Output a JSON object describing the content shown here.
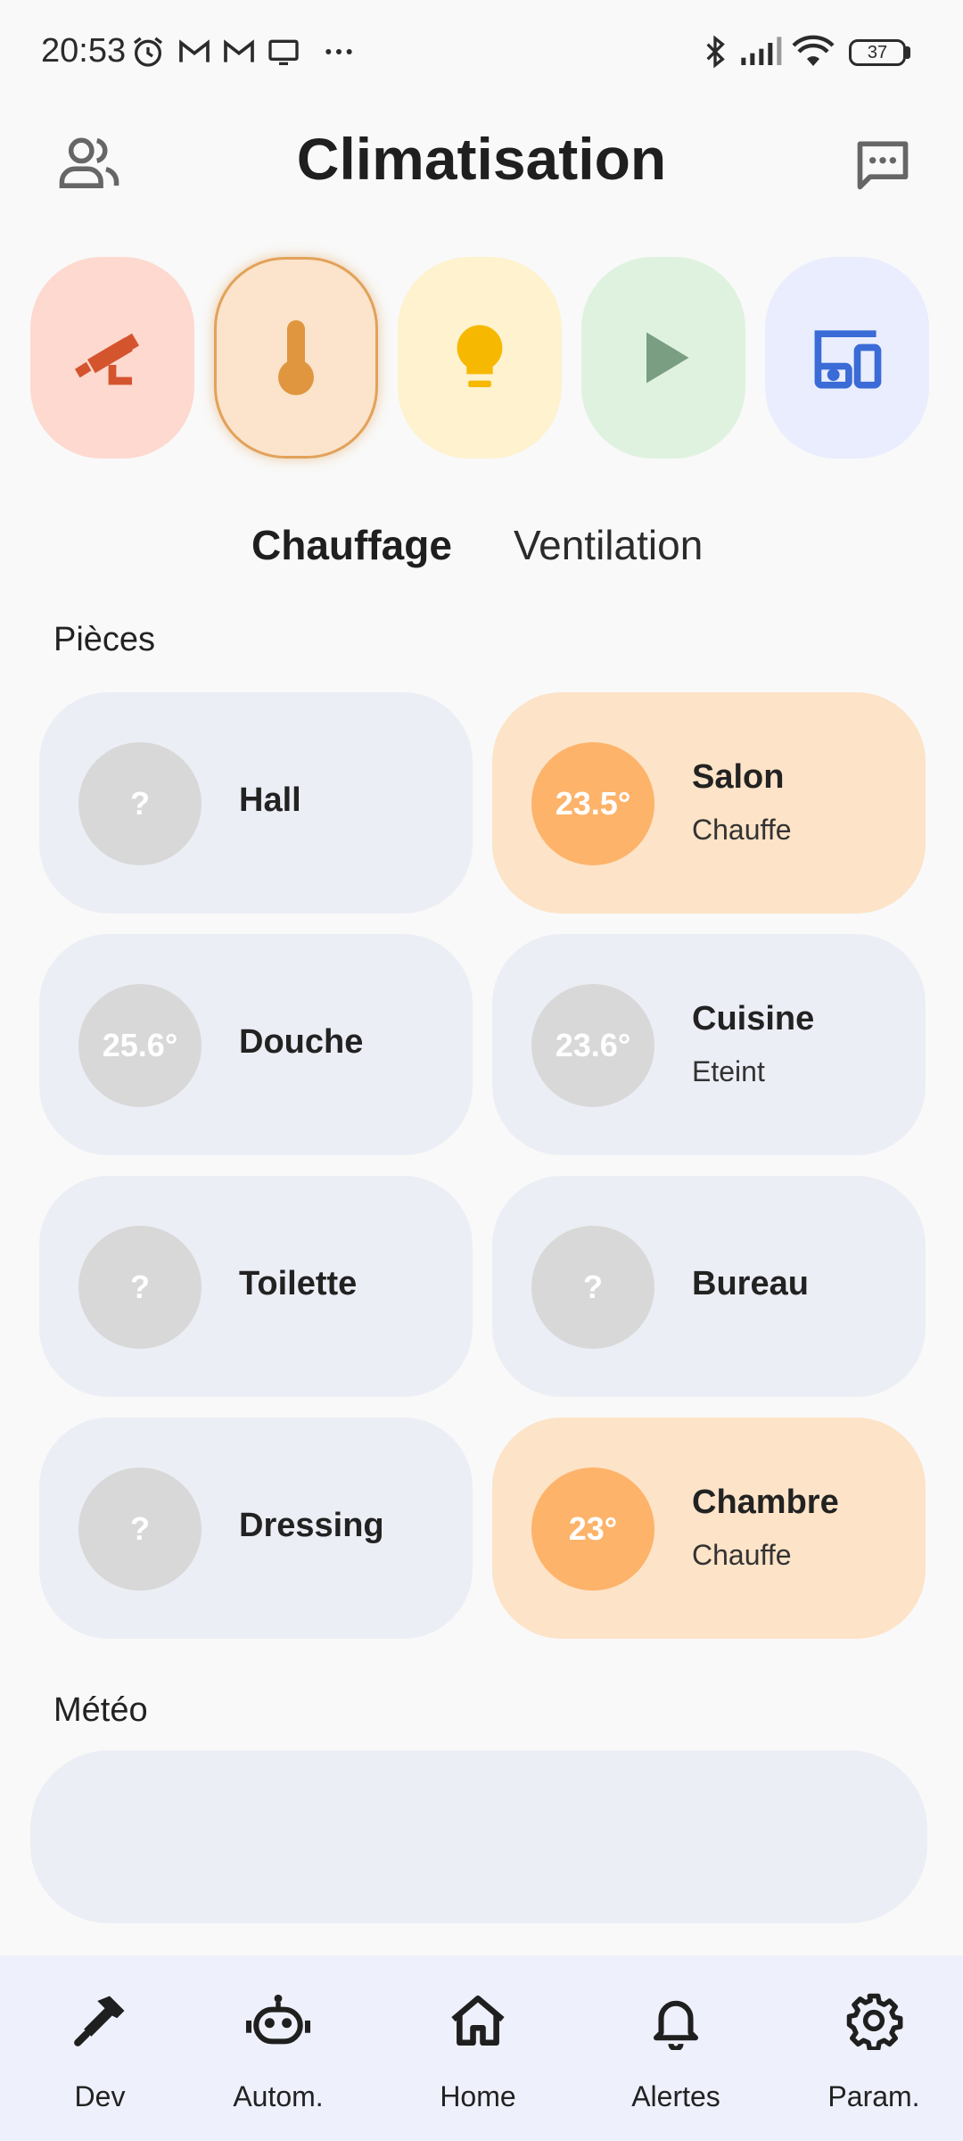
{
  "status_bar": {
    "time": "20:53",
    "icons": [
      "alarm-icon",
      "gmail-icon",
      "gmail-icon",
      "cast-icon",
      "more-icon",
      "bluetooth-icon",
      "signal-icon",
      "wifi-icon"
    ],
    "battery": "37"
  },
  "header": {
    "title": "Climatisation",
    "left_icon": "users-icon",
    "right_icon": "message-icon"
  },
  "categories": [
    {
      "icon": "security-camera-icon",
      "bg": "#fdd9d0",
      "color": "#d4542e"
    },
    {
      "icon": "thermometer-icon",
      "bg": "#fbe3cc",
      "color": "#e0963f",
      "selected": true
    },
    {
      "icon": "lightbulb-icon",
      "bg": "#fef2cf",
      "color": "#f6b800"
    },
    {
      "icon": "play-icon",
      "bg": "#dff2df",
      "color": "#7a9e82"
    },
    {
      "icon": "devices-icon",
      "bg": "#e9edfd",
      "color": "#3a6bd6"
    }
  ],
  "tabs": [
    {
      "label": "Chauffage",
      "active": true
    },
    {
      "label": "Ventilation",
      "active": false
    }
  ],
  "sections": {
    "rooms": "Pièces",
    "weather": "Météo"
  },
  "rooms": [
    {
      "name": "Hall",
      "temp": "?",
      "state": "",
      "active": false
    },
    {
      "name": "Salon",
      "temp": "23.5°",
      "state": "Chauffe",
      "active": true
    },
    {
      "name": "Douche",
      "temp": "25.6°",
      "state": "",
      "active": false
    },
    {
      "name": "Cuisine",
      "temp": "23.6°",
      "state": "Eteint",
      "active": false
    },
    {
      "name": "Toilette",
      "temp": "?",
      "state": "",
      "active": false
    },
    {
      "name": "Bureau",
      "temp": "?",
      "state": "",
      "active": false
    },
    {
      "name": "Dressing",
      "temp": "?",
      "state": "",
      "active": false
    },
    {
      "name": "Chambre",
      "temp": "23°",
      "state": "Chauffe",
      "active": true
    }
  ],
  "colors": {
    "card_inactive": "#eceef5",
    "card_active": "#fde3c7",
    "circle_inactive": "#d8d8d8",
    "circle_active": "#fdb36a"
  },
  "bottom_nav": [
    {
      "label": "Dev",
      "icon": "hammer-icon"
    },
    {
      "label": "Autom.",
      "icon": "robot-icon"
    },
    {
      "label": "Home",
      "icon": "home-icon"
    },
    {
      "label": "Alertes",
      "icon": "bell-icon"
    },
    {
      "label": "Param.",
      "icon": "gear-icon"
    }
  ]
}
